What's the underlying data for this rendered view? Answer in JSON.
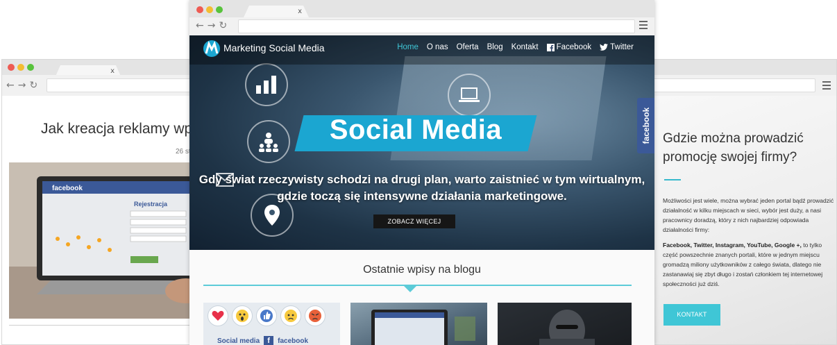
{
  "left_window": {
    "tab_close": "x",
    "article_title": "Jak kreacja reklamy wp",
    "article_date": "26 st",
    "photo_text": {
      "fb_logo": "facebook",
      "register": "Rejestracja"
    }
  },
  "right_window": {
    "heading": "Gdzie można prowadzić promocję swojej firmy?",
    "paragraph1": "Możliwości jest wiele, można wybrać jeden portal bądź prowadzić działalność w kilku miejscach w sieci, wybór jest duży, a nasi pracownicy doradzą, który z nich najbardziej odpowiada działalności firmy:",
    "paragraph2_bold": "Facebook, Twitter, Instagram, YouTube, Google +,",
    "paragraph2_rest": " to tylko część powszechnie znanych portali, które w jednym miejscu gromadzą miliony użytkowników z całego świata, dlatego nie zastanawiaj się zbyt długo i zostań członkiem tej internetowej społeczności już dziś.",
    "kontakt_button": "KONTAKT"
  },
  "center_window": {
    "tab_close": "x",
    "site": {
      "logo_text": "Marketing Social Media",
      "menu": [
        {
          "label": "Home",
          "active": true
        },
        {
          "label": "O nas",
          "active": false
        },
        {
          "label": "Oferta",
          "active": false
        },
        {
          "label": "Blog",
          "active": false
        },
        {
          "label": "Kontakt",
          "active": false
        }
      ],
      "social_facebook": "Facebook",
      "social_twitter": "Twitter",
      "hero_title": "Social Media",
      "hero_subtitle": "Gdy świat rzeczywisty schodzi na drugi plan, warto zaistnieć w tym wirtualnym, gdzie toczą się intensywne działania marketingowe.",
      "hero_button": "ZOBACZ WIĘCEJ",
      "facebook_sidetab": "facebook",
      "blog_heading": "Ostatnie wpisy na blogu",
      "card1_caption_left": "Social media",
      "card1_caption_right": "facebook"
    }
  },
  "colors": {
    "accent": "#3fc6d6",
    "hero_banner": "#1ba6d1",
    "facebook_blue": "#3b5998"
  },
  "icons": [
    "arrow-left-icon",
    "arrow-right-icon",
    "refresh-icon",
    "hamburger-menu-icon",
    "facebook-icon",
    "twitter-icon",
    "bar-chart-icon",
    "laptop-icon",
    "people-hierarchy-icon",
    "envelope-icon",
    "location-pin-icon"
  ]
}
